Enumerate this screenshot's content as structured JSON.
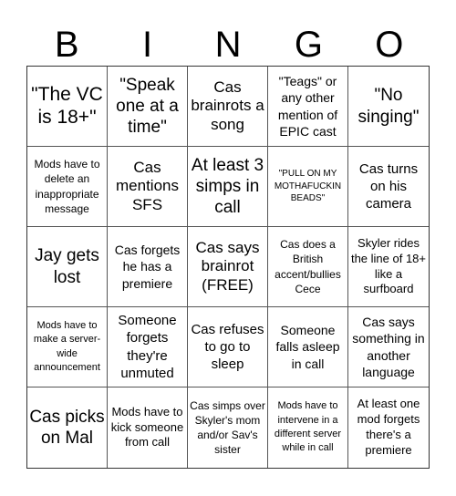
{
  "header": [
    "B",
    "I",
    "N",
    "G",
    "O"
  ],
  "cells": [
    "\"The VC is 18+\"",
    "\"Speak one at a time\"",
    "Cas brainrots a song",
    "\"Teags\" or any other mention of EPIC cast",
    "\"No singing\"",
    "Mods have to delete an inappropriate message",
    "Cas mentions SFS",
    "At least 3 simps in call",
    "\"PULL ON MY MOTHAFUCKIN BEADS\"",
    "Cas turns on his camera",
    "Jay gets lost",
    "Cas forgets he has a premiere",
    "Cas says brainrot (FREE)",
    "Cas does a British accent/bullies Cece",
    "Skyler rides the line of 18+ like a surfboard",
    "Mods have to make a server-wide announcement",
    "Someone forgets they're unmuted",
    "Cas refuses to go to sleep",
    "Someone falls asleep in call",
    "Cas says something in another language",
    "Cas picks on Mal",
    "Mods have to kick someone from call",
    "Cas simps over Skyler's mom and/or Sav's sister",
    "Mods have to intervene in a different server while in call",
    "At least one mod forgets there's a premiere"
  ]
}
